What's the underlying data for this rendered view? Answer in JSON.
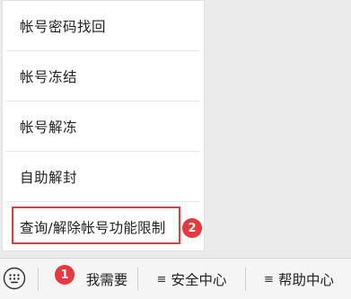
{
  "menu": {
    "items": [
      {
        "label": "帐号密码找回"
      },
      {
        "label": "帐号冻结"
      },
      {
        "label": "帐号解冻"
      },
      {
        "label": "自助解封"
      },
      {
        "label": "查询/解除帐号功能限制"
      }
    ]
  },
  "annotations": {
    "step1": "1",
    "step2": "2",
    "color": "#e8383d"
  },
  "bottom_bar": {
    "keyboard_icon": "keyboard-icon",
    "tabs": [
      {
        "label": "我需要",
        "icon": "none"
      },
      {
        "label": "安全中心",
        "icon": "menu-lines-icon",
        "glyph": "≡"
      },
      {
        "label": "帮助中心",
        "icon": "menu-lines-icon",
        "glyph": "≡"
      }
    ]
  }
}
